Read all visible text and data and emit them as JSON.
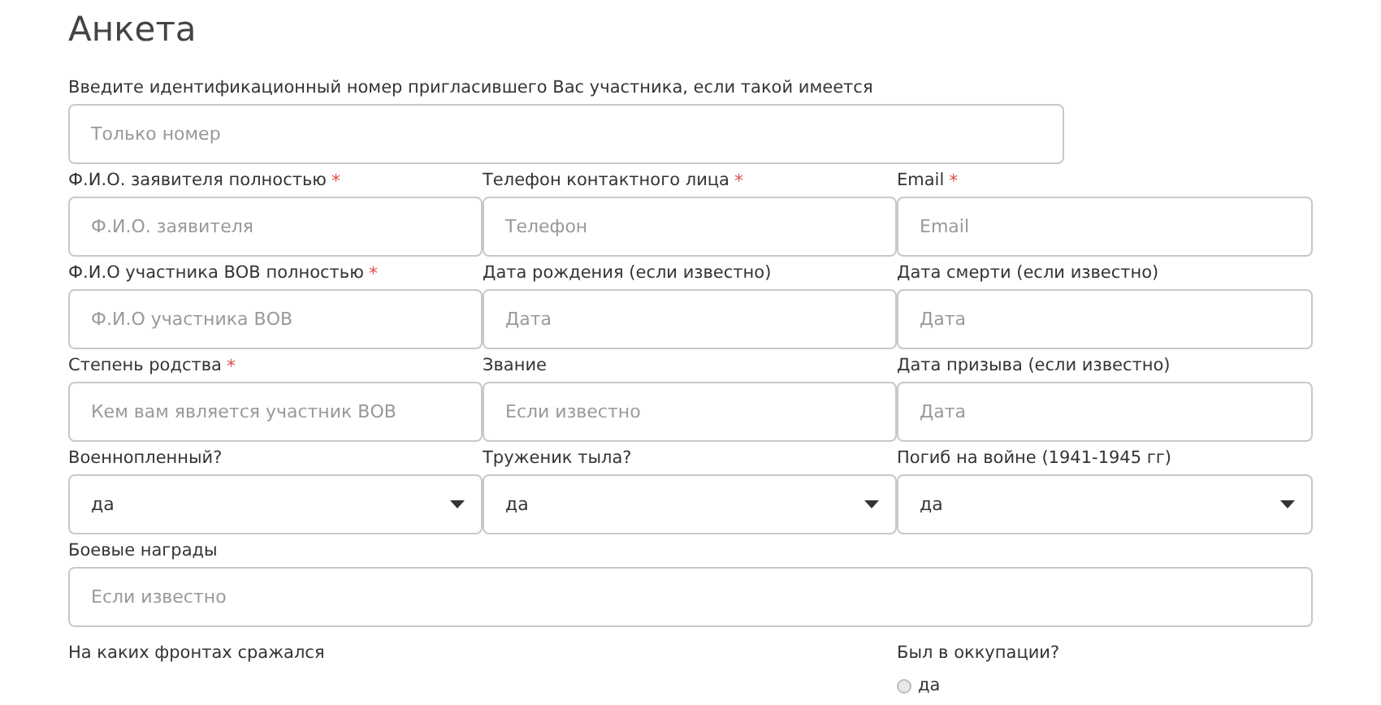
{
  "title": "Анкета",
  "rows": [
    [
      {
        "kind": "text",
        "label": "Введите идентификационный номер пригласившего Вас участника, если такой имеется",
        "placeholder": "Только номер"
      }
    ],
    [
      {
        "kind": "text",
        "label": "Ф.И.О. заявителя полностью",
        "required_mark": "*",
        "placeholder": "Ф.И.О. заявителя"
      },
      {
        "kind": "text",
        "label": "Телефон контактного лица",
        "required_mark": "*",
        "placeholder": "Телефон"
      },
      {
        "kind": "text",
        "label": "Email",
        "required_mark": "*",
        "placeholder": "Email"
      }
    ],
    [
      {
        "kind": "text",
        "label": "Ф.И.О участника ВОВ полностью",
        "required_mark": "*",
        "placeholder": "Ф.И.О участника ВОВ"
      },
      {
        "kind": "text",
        "label": "Дата рождения (если известно)",
        "placeholder": "Дата"
      },
      {
        "kind": "text",
        "label": "Дата смерти (если известно)",
        "placeholder": "Дата"
      }
    ],
    [
      {
        "kind": "text",
        "label": "Степень родства",
        "required_mark": "*",
        "placeholder": "Кем вам является участник ВОВ"
      },
      {
        "kind": "text",
        "label": "Звание",
        "placeholder": "Если известно"
      },
      {
        "kind": "text",
        "label": "Дата призыва (если известно)",
        "placeholder": "Дата"
      }
    ],
    [
      {
        "kind": "select",
        "label": "Военнопленный?",
        "value": "да"
      },
      {
        "kind": "select",
        "label": "Труженик тыла?",
        "value": "да"
      },
      {
        "kind": "select",
        "label": "Погиб на войне (1941-1945 гг)",
        "value": "да"
      }
    ],
    [
      {
        "kind": "text",
        "label": "Боевые награды",
        "placeholder": "Если известно"
      }
    ],
    [
      {
        "kind": "label",
        "label": "На каких фронтах сражался"
      },
      {
        "kind": "radio",
        "label": "Был в оккупации?",
        "options": [
          {
            "label": "да",
            "selected": false
          }
        ]
      }
    ]
  ]
}
